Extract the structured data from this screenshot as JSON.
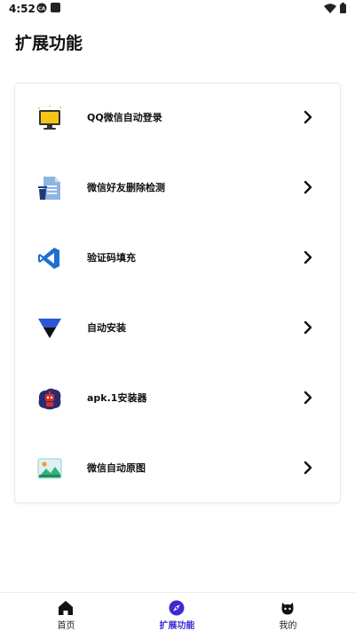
{
  "status": {
    "time": "4:52"
  },
  "page": {
    "title": "扩展功能"
  },
  "features": [
    {
      "label": "QQ微信自动登录",
      "icon": "monitor-icon"
    },
    {
      "label": "微信好友删除检测",
      "icon": "document-trash-icon"
    },
    {
      "label": "验证码填充",
      "icon": "vscode-icon"
    },
    {
      "label": "自动安装",
      "icon": "triangle-download-icon"
    },
    {
      "label": "apk.1安装器",
      "icon": "robot-icon"
    },
    {
      "label": "微信自动原图",
      "icon": "image-icon"
    }
  ],
  "nav": {
    "home": "首页",
    "extensions": "扩展功能",
    "mine": "我的",
    "active": "extensions"
  },
  "colors": {
    "accent": "#3b2bd1"
  }
}
